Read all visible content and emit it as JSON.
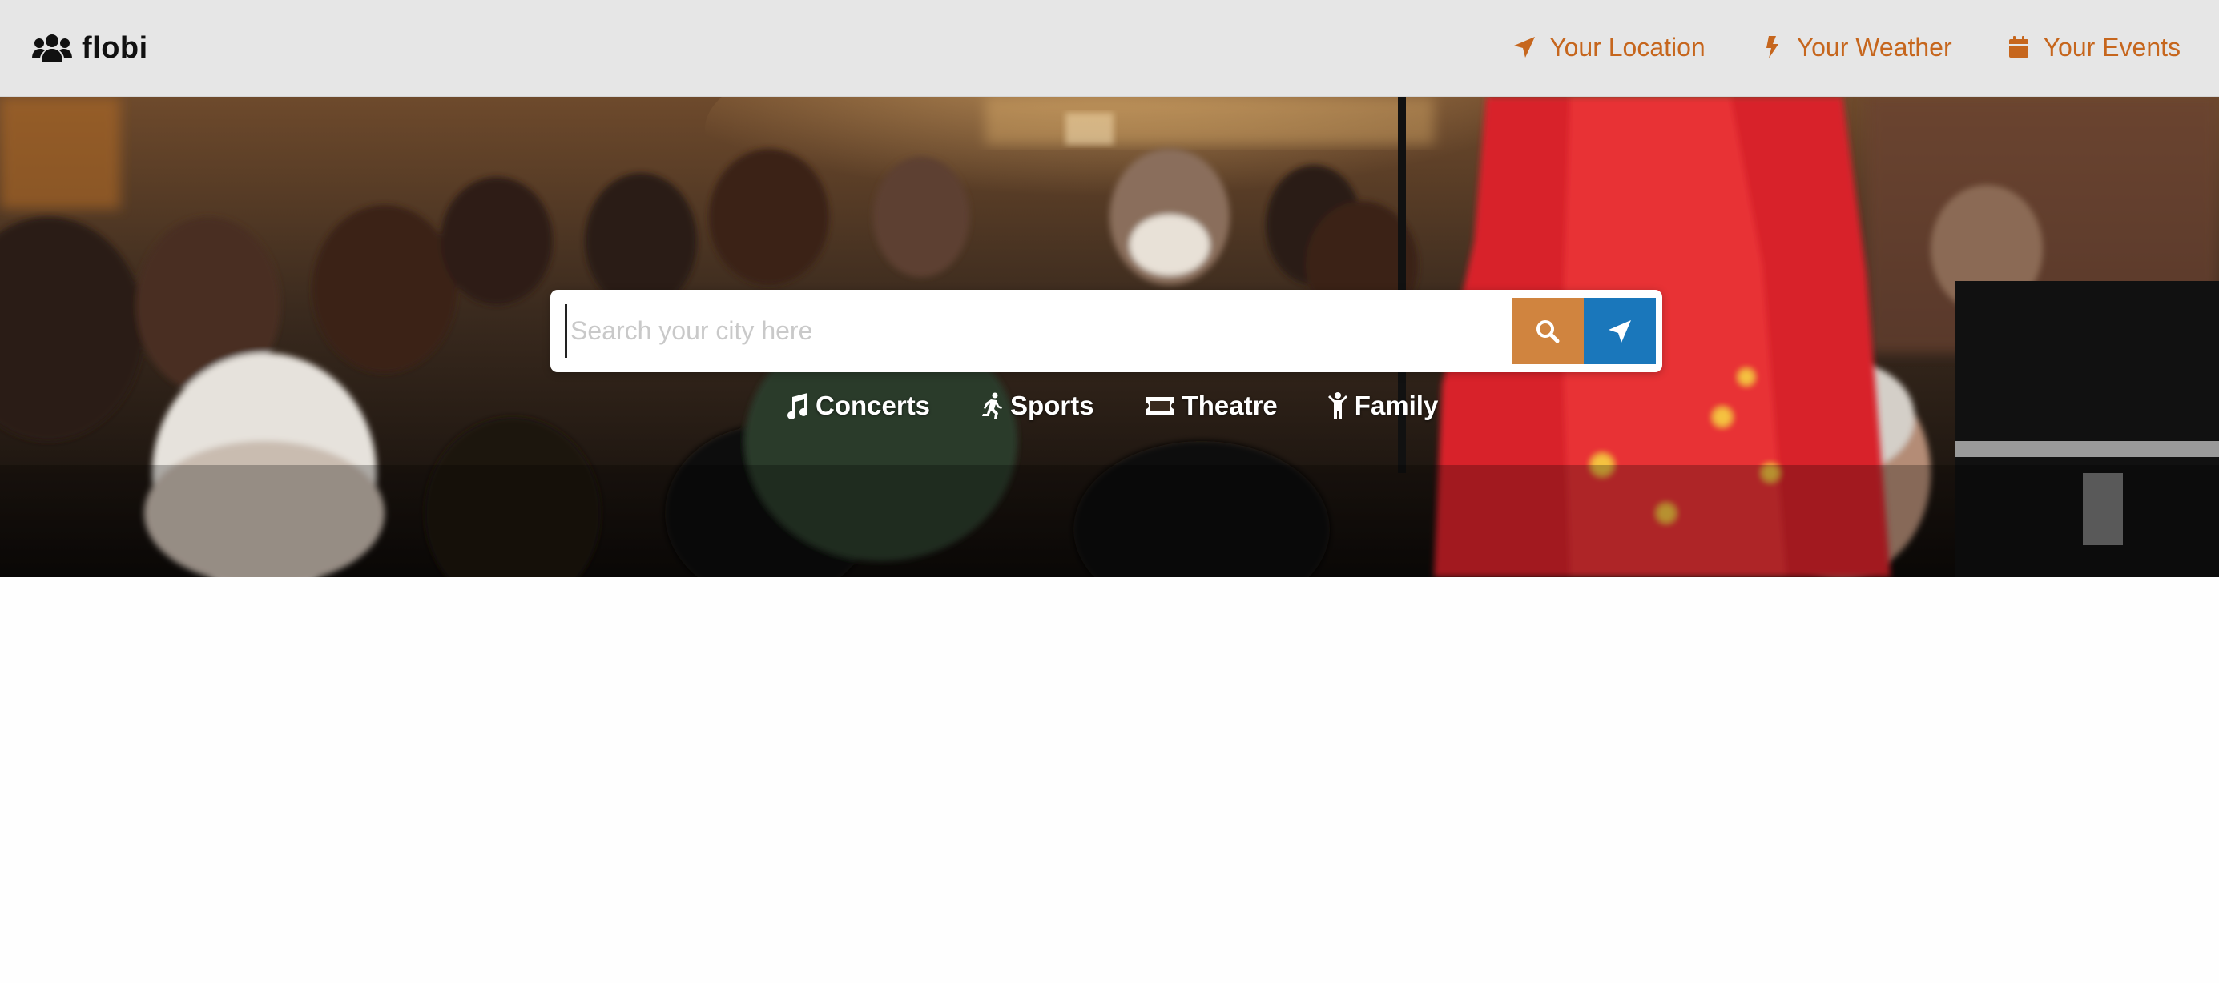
{
  "brand": {
    "name": "flobi",
    "icon": "users-icon"
  },
  "nav": [
    {
      "label": "Your Location",
      "icon": "location-arrow-icon"
    },
    {
      "label": "Your Weather",
      "icon": "bolt-icon"
    },
    {
      "label": "Your Events",
      "icon": "calendar-icon"
    }
  ],
  "search": {
    "placeholder": "Search your city here",
    "value": "",
    "search_button_icon": "search-icon",
    "locate_button_icon": "location-arrow-icon"
  },
  "categories": [
    {
      "label": "Concerts",
      "icon": "music-icon"
    },
    {
      "label": "Sports",
      "icon": "running-icon"
    },
    {
      "label": "Theatre",
      "icon": "ticket-icon"
    },
    {
      "label": "Family",
      "icon": "child-icon"
    }
  ],
  "colors": {
    "accent_orange": "#c6661d",
    "search_button": "#d0843f",
    "locate_button": "#1a77bb",
    "navbar_bg": "#e6e6e6"
  }
}
